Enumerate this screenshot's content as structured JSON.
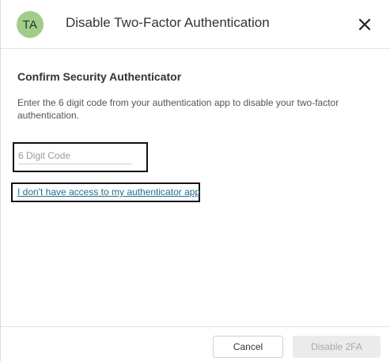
{
  "header": {
    "avatar_initials": "TA",
    "title": "Disable Two-Factor Authentication",
    "close_icon": "close-icon"
  },
  "content": {
    "section_title": "Confirm Security Authenticator",
    "description": "Enter the 6 digit code from your authentication app to disable your two-factor authentication.",
    "code_input": {
      "placeholder": "6 Digit Code",
      "value": ""
    },
    "no_access_link": "I don't have access to my authenticator app"
  },
  "footer": {
    "cancel_label": "Cancel",
    "disable_label": "Disable 2FA",
    "disable_enabled": false
  },
  "colors": {
    "avatar_bg": "#a3cc8a",
    "link": "#1e6f88",
    "disabled_button_bg": "#ebebeb"
  }
}
